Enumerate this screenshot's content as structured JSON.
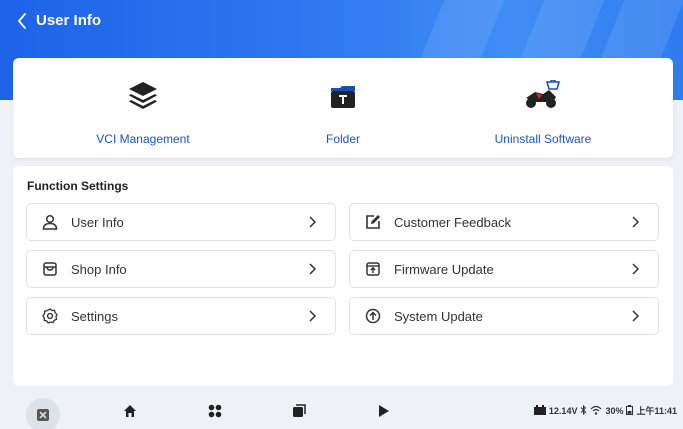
{
  "header": {
    "title": "User Info"
  },
  "tools": [
    {
      "label": "VCI Management",
      "icon": "layers-icon"
    },
    {
      "label": "Folder",
      "icon": "folder-icon"
    },
    {
      "label": "Uninstall Software",
      "icon": "motorbike-basket-icon"
    }
  ],
  "function_settings": {
    "title": "Function Settings",
    "items": [
      {
        "label": "User Info",
        "icon": "user-icon"
      },
      {
        "label": "Customer Feedback",
        "icon": "edit-icon"
      },
      {
        "label": "Shop Info",
        "icon": "shop-icon"
      },
      {
        "label": "Firmware Update",
        "icon": "upload-box-icon"
      },
      {
        "label": "Settings",
        "icon": "gear-icon"
      },
      {
        "label": "System Update",
        "icon": "arrow-up-circle-icon"
      }
    ]
  },
  "status_bar": {
    "voltage": "12.14V",
    "battery": "30%",
    "time": "上午11:41"
  },
  "colors": {
    "accent": "#1e63e8",
    "link": "#1b56c8"
  }
}
